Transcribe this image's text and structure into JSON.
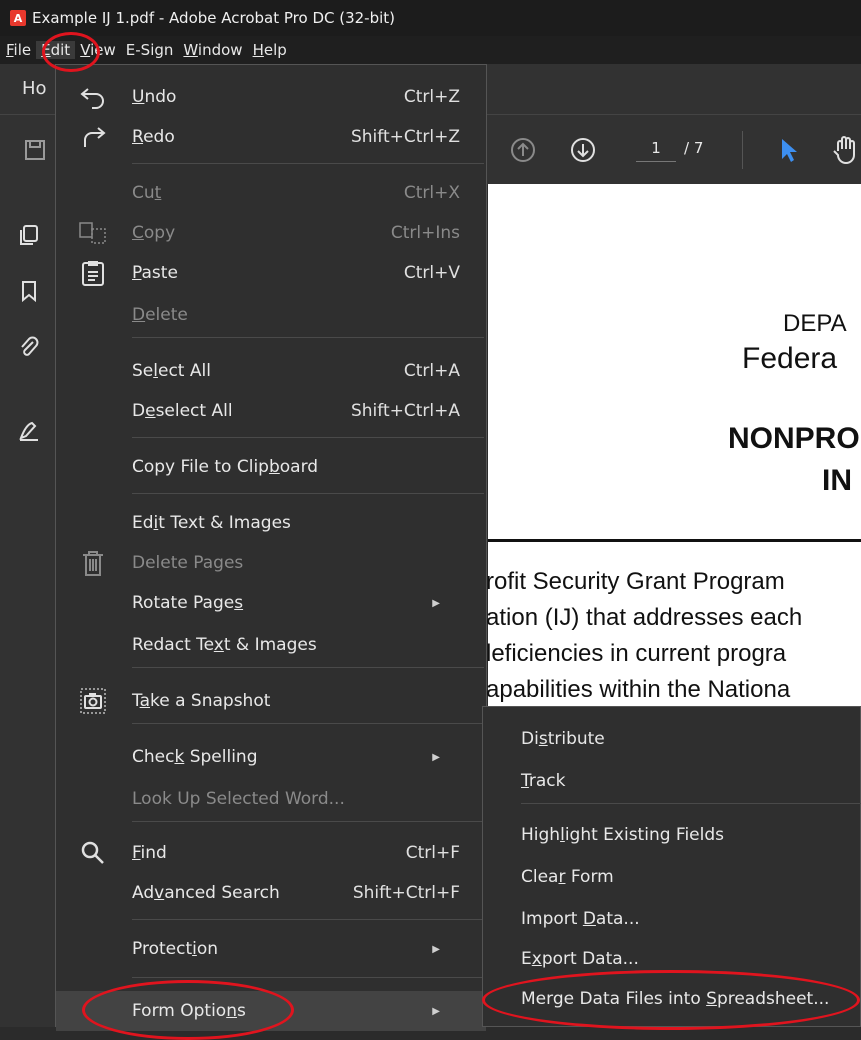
{
  "window": {
    "title": "Example IJ 1.pdf - Adobe Acrobat Pro DC (32-bit)"
  },
  "menubar": [
    {
      "pre": "",
      "u": "F",
      "post": "ile"
    },
    {
      "pre": "",
      "u": "E",
      "post": "dit"
    },
    {
      "pre": "",
      "u": "V",
      "post": "iew"
    },
    {
      "pre": "E-Sign",
      "u": "",
      "post": ""
    },
    {
      "pre": "",
      "u": "W",
      "post": "indow"
    },
    {
      "pre": "",
      "u": "H",
      "post": "elp"
    }
  ],
  "tabs": {
    "home": "Ho"
  },
  "toolbar": {
    "page_current": "1",
    "page_total": "/ 7"
  },
  "edit_menu": [
    {
      "name": "undo",
      "pre": "",
      "u": "U",
      "post": "ndo",
      "shortcut": "Ctrl+Z",
      "icon": "undo-icon",
      "disabled": false
    },
    {
      "name": "redo",
      "pre": "",
      "u": "R",
      "post": "edo",
      "shortcut": "Shift+Ctrl+Z",
      "icon": "redo-icon",
      "disabled": false
    },
    {
      "name": "cut",
      "pre": "Cu",
      "u": "t",
      "post": "",
      "shortcut": "Ctrl+X",
      "icon": "",
      "disabled": true
    },
    {
      "name": "copy",
      "pre": "",
      "u": "C",
      "post": "opy",
      "shortcut": "Ctrl+Ins",
      "icon": "copy-icon",
      "disabled": true
    },
    {
      "name": "paste",
      "pre": "",
      "u": "P",
      "post": "aste",
      "shortcut": "Ctrl+V",
      "icon": "paste-icon",
      "disabled": false
    },
    {
      "name": "delete",
      "pre": "",
      "u": "D",
      "post": "elete",
      "shortcut": "",
      "icon": "",
      "disabled": true
    },
    {
      "name": "select-all",
      "pre": "Se",
      "u": "l",
      "post": "ect All",
      "shortcut": "Ctrl+A",
      "icon": "",
      "disabled": false
    },
    {
      "name": "deselect-all",
      "pre": "D",
      "u": "e",
      "post": "select All",
      "shortcut": "Shift+Ctrl+A",
      "icon": "",
      "disabled": false
    },
    {
      "name": "copy-file-to-clipboard",
      "pre": "Copy File to Clip",
      "u": "b",
      "post": "oard",
      "shortcut": "",
      "icon": "",
      "disabled": false
    },
    {
      "name": "edit-text-images",
      "pre": "Ed",
      "u": "i",
      "post": "t Text & Images",
      "shortcut": "",
      "icon": "",
      "disabled": false
    },
    {
      "name": "delete-pages",
      "pre": "Delete Pages",
      "u": "",
      "post": "",
      "shortcut": "",
      "icon": "trash-icon",
      "disabled": true
    },
    {
      "name": "rotate-pages",
      "pre": "Rotate Page",
      "u": "s",
      "post": "",
      "shortcut": "",
      "icon": "",
      "disabled": false,
      "submenu": true
    },
    {
      "name": "redact-text-images",
      "pre": "Redact Te",
      "u": "x",
      "post": "t & Images",
      "shortcut": "",
      "icon": "",
      "disabled": false
    },
    {
      "name": "take-a-snapshot",
      "pre": "T",
      "u": "a",
      "post": "ke a Snapshot",
      "shortcut": "",
      "icon": "camera-icon",
      "disabled": false
    },
    {
      "name": "check-spelling",
      "pre": "Chec",
      "u": "k",
      "post": " Spelling",
      "shortcut": "",
      "icon": "",
      "disabled": false,
      "submenu": true
    },
    {
      "name": "look-up-selected-word",
      "pre": "Look Up Selected Word...",
      "u": "",
      "post": "",
      "shortcut": "",
      "icon": "",
      "disabled": true
    },
    {
      "name": "find",
      "pre": "",
      "u": "F",
      "post": "ind",
      "shortcut": "Ctrl+F",
      "icon": "search-icon",
      "disabled": false
    },
    {
      "name": "advanced-search",
      "pre": "Ad",
      "u": "v",
      "post": "anced Search",
      "shortcut": "Shift+Ctrl+F",
      "icon": "",
      "disabled": false
    },
    {
      "name": "protection",
      "pre": "Protect",
      "u": "i",
      "post": "on",
      "shortcut": "",
      "icon": "",
      "disabled": false,
      "submenu": true
    },
    {
      "name": "form-options",
      "pre": "Form Optio",
      "u": "n",
      "post": "s",
      "shortcut": "",
      "icon": "",
      "disabled": false,
      "submenu": true
    }
  ],
  "form_submenu": [
    {
      "name": "distribute",
      "pre": "Di",
      "u": "s",
      "post": "tribute"
    },
    {
      "name": "track",
      "pre": "",
      "u": "T",
      "post": "rack"
    },
    {
      "name": "highlight-existing-fields",
      "pre": "High",
      "u": "l",
      "post": "ight Existing Fields"
    },
    {
      "name": "clear-form",
      "pre": "Clea",
      "u": "r",
      "post": " Form"
    },
    {
      "name": "import-data",
      "pre": "Import ",
      "u": "D",
      "post": "ata..."
    },
    {
      "name": "export-data",
      "pre": "E",
      "u": "x",
      "post": "port Data..."
    },
    {
      "name": "merge-data-files",
      "pre": "Merge Data Files into ",
      "u": "S",
      "post": "preadsheet..."
    }
  ],
  "document": {
    "line1": "DEPA",
    "line2": "Federa",
    "line3": "NONPRO",
    "line4": "IN",
    "para": [
      "rofit Security Grant Program",
      "ation (IJ) that addresses each",
      "leficiencies in current progra",
      "apabilities within the Nationa"
    ]
  },
  "annotation_color": "#e0141e"
}
